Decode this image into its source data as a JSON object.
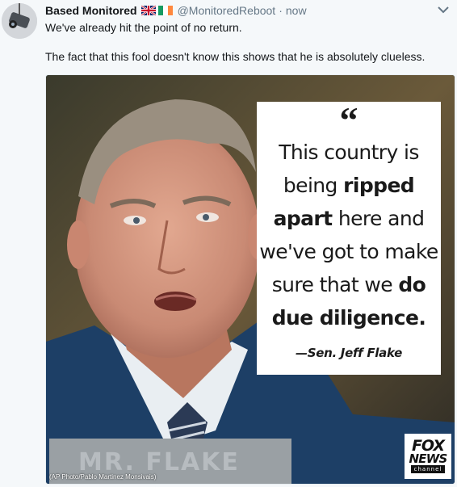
{
  "tweet": {
    "author_name": "Based Monitored",
    "handle": "@MonitoredReboot",
    "separator": "·",
    "time": "now",
    "flags": [
      "uk-flag-icon",
      "ireland-flag-icon"
    ],
    "text_lines": [
      "We've already hit the point of no return.",
      "The fact that this fool doesn't know this shows that he is absolutely clueless."
    ]
  },
  "media": {
    "quote_mark": "“",
    "quote_lines": [
      [
        {
          "t": "This country is",
          "b": false
        }
      ],
      [
        {
          "t": "being ",
          "b": false
        },
        {
          "t": "ripped",
          "b": true
        }
      ],
      [
        {
          "t": "apart",
          "b": true
        },
        {
          "t": " here and",
          "b": false
        }
      ],
      [
        {
          "t": "we've got to make",
          "b": false
        }
      ],
      [
        {
          "t": "sure that we ",
          "b": false
        },
        {
          "t": "do",
          "b": true
        }
      ],
      [
        {
          "t": "due diligence.",
          "b": true
        }
      ]
    ],
    "attribution": "—Sen. Jeff Flake",
    "photo_credit": "(AP Photo/Pablo Martinez Monsivais)",
    "nameplate": "MR. FLAKE",
    "logo": {
      "line1": "FOX",
      "line2": "NEWS",
      "line3": "channel"
    }
  },
  "colors": {
    "accent": "#1da1f2",
    "muted": "#657786",
    "suit": "#1d3f66"
  }
}
